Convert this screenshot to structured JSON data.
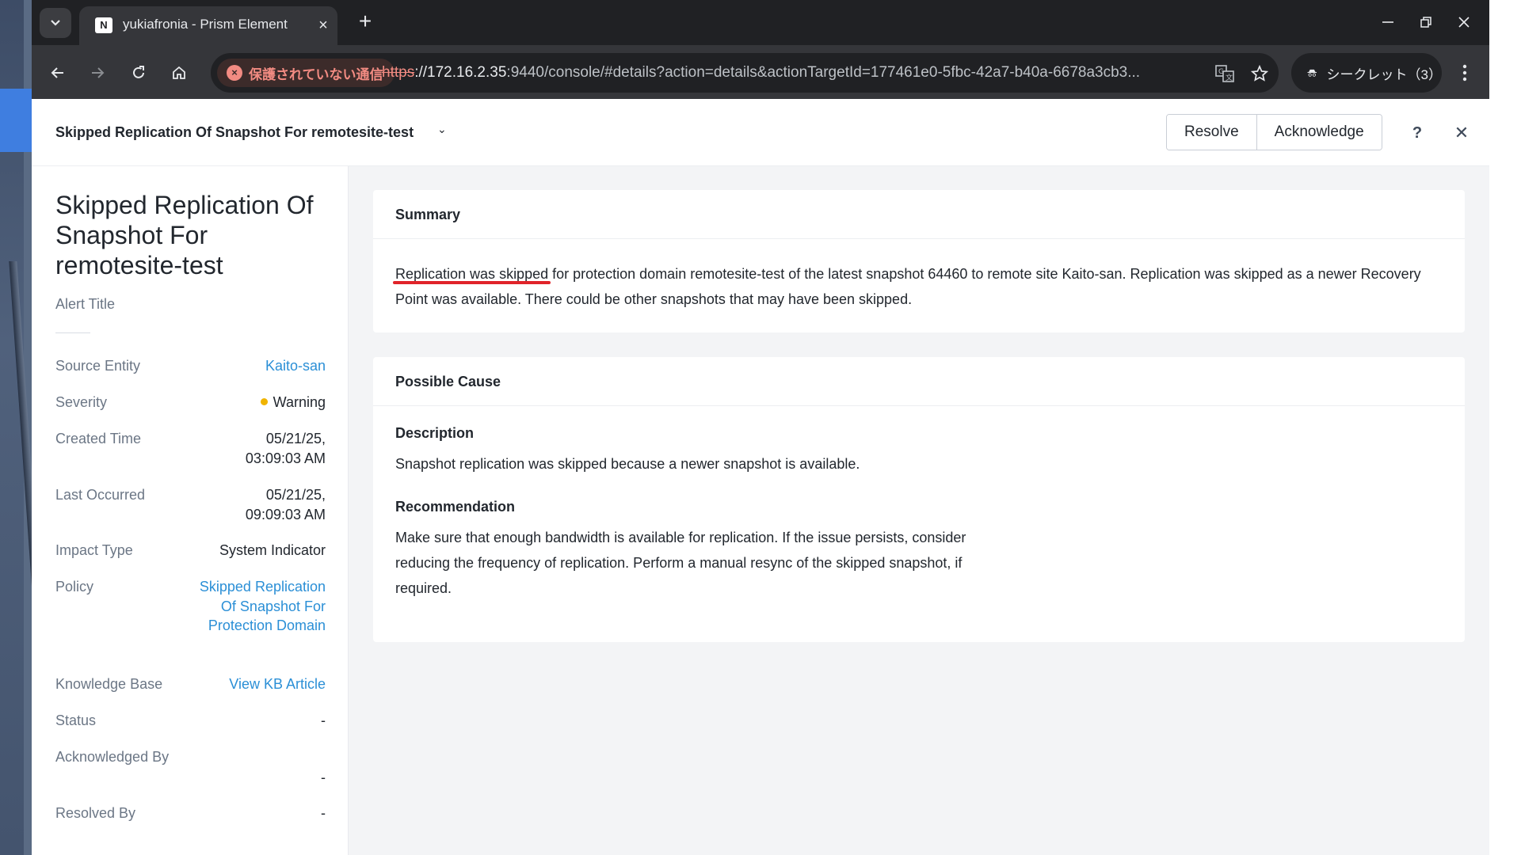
{
  "browser": {
    "tab_title": "yukiafronia - Prism Element",
    "favicon_text": "N",
    "security_label": "保護されていない通信",
    "url_scheme": "https",
    "url_host": "://172.16.2.35",
    "url_rest": ":9440/console/#details?action=details&actionTargetId=177461e0-5fbc-42a7-b40a-6678a3cb3...",
    "incognito_label": "シークレット（3）"
  },
  "header": {
    "title": "Skipped Replication Of Snapshot For remotesite-test",
    "resolve_label": "Resolve",
    "acknowledge_label": "Acknowledge",
    "help_label": "?",
    "close_label": "✕"
  },
  "details": {
    "title": "Skipped Replication Of Snapshot For remotesite-test",
    "subtitle": "Alert Title",
    "rows": [
      {
        "label": "Source Entity",
        "value": "Kaito-san"
      },
      {
        "label": "Severity",
        "value": "Warning"
      },
      {
        "label": "Created Time",
        "value": "05/21/25, 03:09:03 AM"
      },
      {
        "label": "Last Occurred",
        "value": "05/21/25, 09:09:03 AM"
      },
      {
        "label": "Impact Type",
        "value": "System Indicator"
      },
      {
        "label": "Policy",
        "value": "Skipped Replication Of Snapshot For Protection Domain"
      },
      {
        "label": "Knowledge Base",
        "value": "View KB Article"
      },
      {
        "label": "Status",
        "value": "-"
      },
      {
        "label": "Acknowledged By",
        "value": "-"
      },
      {
        "label": "Resolved By",
        "value": "-"
      }
    ]
  },
  "summary": {
    "heading": "Summary",
    "highlight": "Replication was skipped",
    "text_rest": " for protection domain remotesite-test of the latest snapshot 64460 to remote site Kaito-san. Replication was skipped as a newer Recovery Point was available. There could be other snapshots that may have been skipped."
  },
  "cause": {
    "heading": "Possible Cause",
    "description_heading": "Description",
    "description": "Snapshot replication was skipped because a newer snapshot is available.",
    "recommendation_heading": "Recommendation",
    "recommendation": "Make sure that enough bandwidth is available for replication. If the issue persists, consider reducing the frequency of replication. Perform a manual resync of the skipped snapshot, if required."
  },
  "colors": {
    "link": "#2b8fd6",
    "warning": "#f0b400",
    "highlight_underline": "#e0242a",
    "browser_dark": "#202124"
  }
}
